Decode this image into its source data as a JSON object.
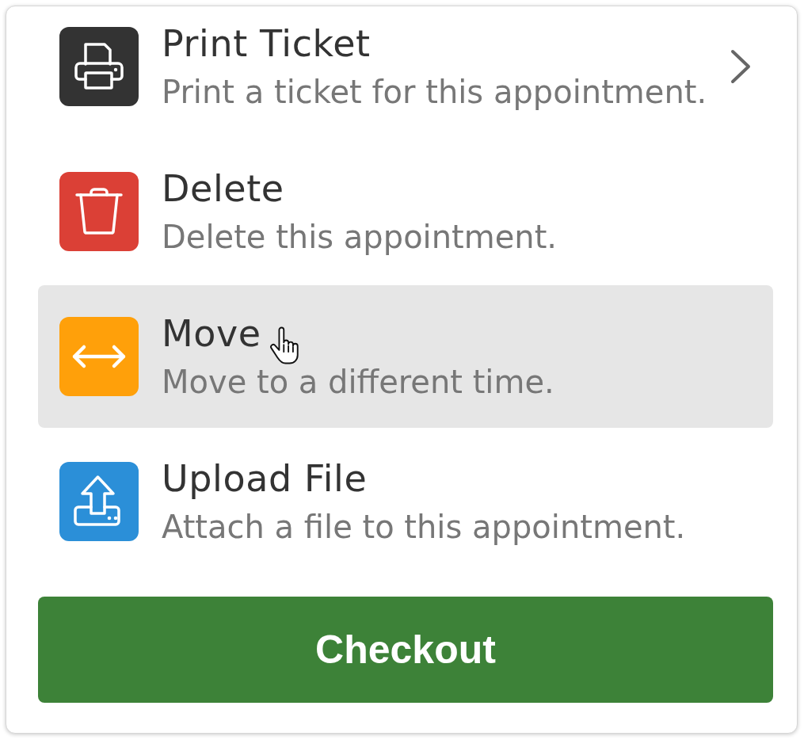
{
  "items": [
    {
      "kind": "printer",
      "color": "#333333",
      "title": "Print Ticket",
      "description": "Print a ticket for this appointment.",
      "submenu": true,
      "highlighted": false
    },
    {
      "kind": "trash",
      "color": "#db4036",
      "title": "Delete",
      "description": "Delete this appointment.",
      "submenu": false,
      "highlighted": false
    },
    {
      "kind": "arrows",
      "color": "#ffa00a",
      "title": "Move",
      "description": "Move to a different time.",
      "submenu": false,
      "highlighted": true
    },
    {
      "kind": "upload",
      "color": "#2b8fd8",
      "title": "Upload File",
      "description": "Attach a file to this appointment.",
      "submenu": false,
      "highlighted": false
    }
  ],
  "checkout_button": {
    "label": "Checkout"
  }
}
